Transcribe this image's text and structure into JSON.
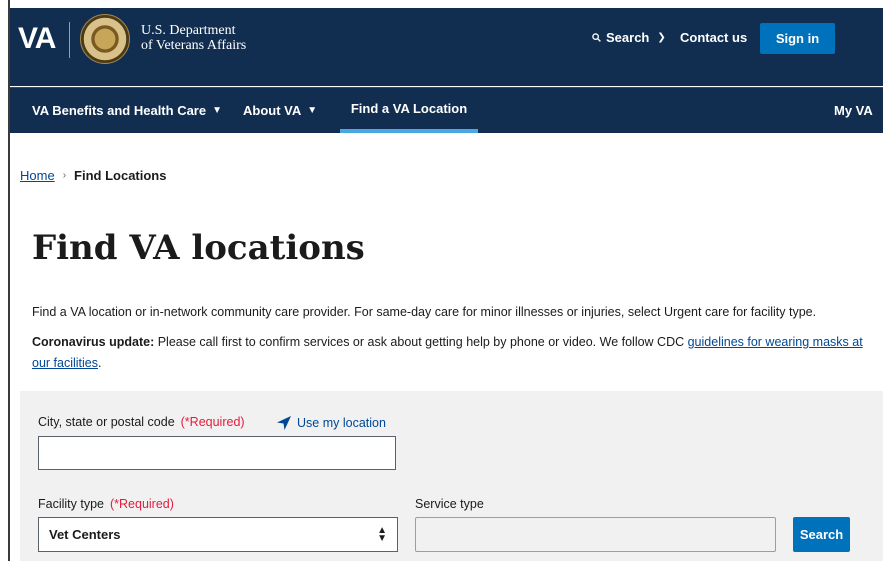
{
  "header": {
    "logo_text": "VA",
    "agency_line1": "U.S. Department",
    "agency_line2": "of Veterans Affairs",
    "search_label": "Search",
    "contact_label": "Contact us",
    "signin_label": "Sign in",
    "colors": {
      "header_bg": "#112e51",
      "primary_button": "#0071bb",
      "active_underline": "#4aa8e0"
    }
  },
  "nav": {
    "items": [
      {
        "label": "VA Benefits and Health Care",
        "has_dropdown": true
      },
      {
        "label": "About VA",
        "has_dropdown": true
      },
      {
        "label": "Find a VA Location",
        "active": true
      },
      {
        "label": "My VA"
      }
    ]
  },
  "breadcrumb": {
    "home": "Home",
    "current": "Find Locations"
  },
  "page": {
    "title": "Find VA locations",
    "intro": "Find a VA location or in-network community care provider. For same-day care for minor illnesses or injuries, select Urgent care for facility type.",
    "covid_label": "Coronavirus update:",
    "covid_text": " Please call first to confirm services or ask about getting help by phone or video. We follow CDC ",
    "covid_link": "guidelines for wearing masks at our facilities",
    "covid_end": "."
  },
  "form": {
    "location_label": "City, state or postal code",
    "required_text": "(*Required)",
    "use_location_label": "Use my location",
    "location_value": "",
    "facility_label": "Facility type",
    "facility_value": "Vet Centers",
    "service_label": "Service type",
    "service_value": "",
    "search_button": "Search"
  }
}
